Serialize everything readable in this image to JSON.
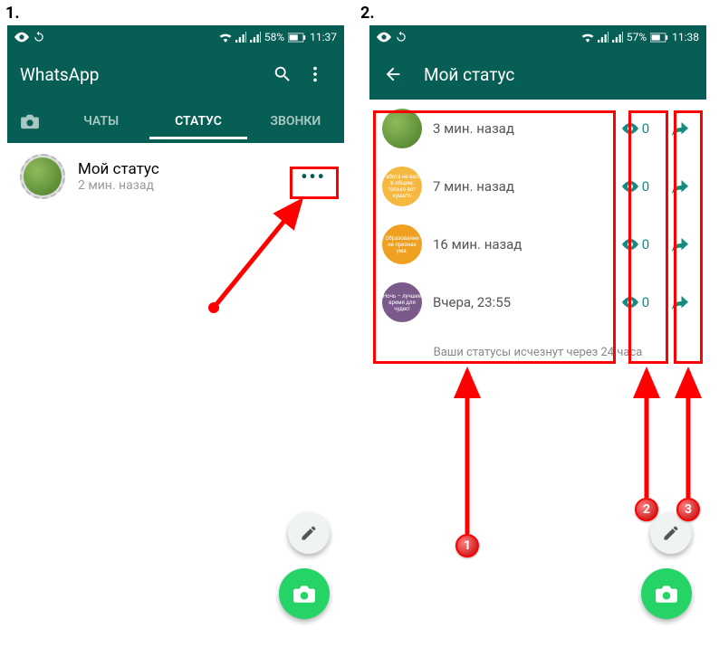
{
  "labels": {
    "one": "1.",
    "two": "2."
  },
  "screen1": {
    "status": {
      "battery": "58%",
      "time": "11:37"
    },
    "appTitle": "WhatsApp",
    "tabs": {
      "chats": "ЧАТЫ",
      "status": "СТАТУС",
      "calls": "ЗВОНКИ"
    },
    "myStatus": {
      "title": "Мой статус",
      "time": "2 мин. назад",
      "menu": "•••"
    }
  },
  "screen2": {
    "status": {
      "battery": "57%",
      "time": "11:38"
    },
    "title": "Мой статус",
    "rows": [
      {
        "time": "3 мин. назад",
        "views": "0",
        "color": "radial-gradient(circle at 35% 35%, #8fbc5a, #4a7a2a)",
        "text": ""
      },
      {
        "time": "7 мин. назад",
        "views": "0",
        "color": "#f5b942",
        "text": "Работа не волк в общем, только вот кушать"
      },
      {
        "time": "16 мин. назад",
        "views": "0",
        "color": "#f0a020",
        "text": "Образование не признак ума."
      },
      {
        "time": "Вчера, 23:55",
        "views": "0",
        "color": "#7a5a8a",
        "text": "Ночь – лучшее время для чудес!"
      }
    ],
    "footer": "Ваши статусы исчезнут через 24 часа"
  },
  "badges": {
    "b1": "1",
    "b2": "2",
    "b3": "3"
  }
}
